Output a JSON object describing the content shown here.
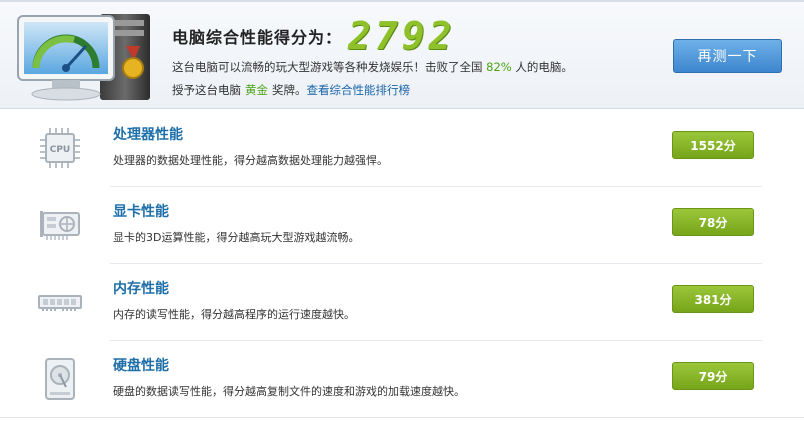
{
  "header": {
    "score_label": "电脑综合性能得分为：",
    "score_value": "2792",
    "desc_prefix": "这台电脑可以流畅的玩大型游戏等各种发烧娱乐！击败了全国",
    "beat_percent": "82%",
    "desc_suffix": "人的电脑。",
    "award_prefix": "授予这台电脑",
    "award_name": "黄金",
    "award_suffix": "奖牌。",
    "rank_link": "查看综合性能排行榜",
    "retest_label": "再测一下"
  },
  "items": [
    {
      "title": "处理器性能",
      "desc": "处理器的数据处理性能，得分越高数据处理能力越强悍。",
      "score": "1552分",
      "icon": "cpu-icon",
      "icon_text": "CPU"
    },
    {
      "title": "显卡性能",
      "desc": "显卡的3D运算性能，得分越高玩大型游戏越流畅。",
      "score": "78分",
      "icon": "graphics-card-icon"
    },
    {
      "title": "内存性能",
      "desc": "内存的读写性能，得分越高程序的运行速度越快。",
      "score": "381分",
      "icon": "memory-icon"
    },
    {
      "title": "硬盘性能",
      "desc": "硬盘的数据读写性能，得分越高复制文件的速度和游戏的加载速度越快。",
      "score": "79分",
      "icon": "hard-disk-icon"
    }
  ],
  "colors": {
    "score_green": "#8fc12b",
    "title_blue": "#1f6fa8",
    "badge_green": "#8cb82b",
    "button_blue": "#4a90d9",
    "link_blue": "#1a64a8"
  }
}
